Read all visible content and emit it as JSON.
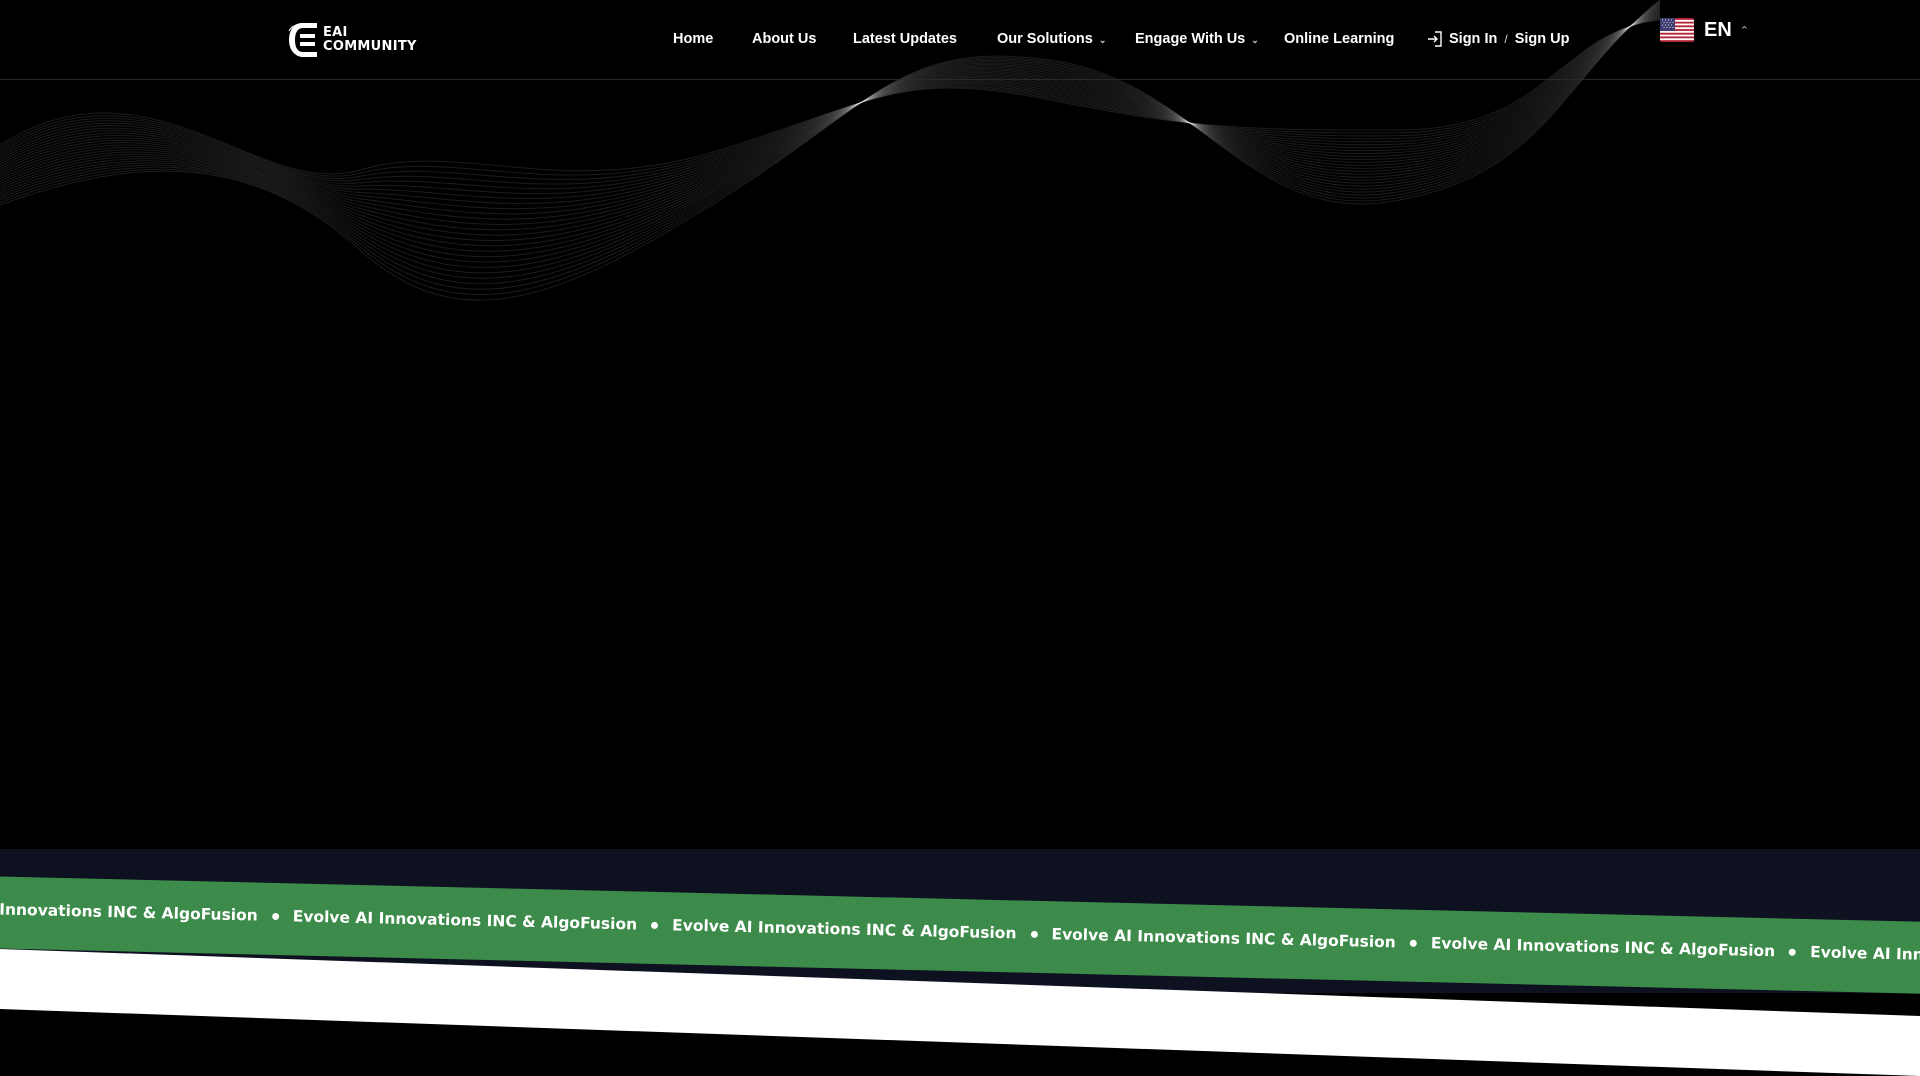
{
  "brand": {
    "name_line1": "EAI",
    "name_line2": "COMMUNITY"
  },
  "nav": {
    "items": [
      {
        "label": "Home"
      },
      {
        "label": "About Us"
      },
      {
        "label": "Latest Updates"
      },
      {
        "label": "Our Solutions",
        "has_dropdown": true
      },
      {
        "label": "Engage With Us",
        "has_dropdown": true
      },
      {
        "label": "Online Learning"
      }
    ],
    "sign_in": "Sign In",
    "separator": "/",
    "sign_up": "Sign Up",
    "sign_in_icon": "sign-in-icon"
  },
  "language": {
    "code": "EN",
    "flag_icon": "us-flag-icon",
    "caret_icon": "chevron-up-icon"
  },
  "ticker": {
    "first_text": "Innovations INC & AlgoFusion",
    "text": "Evolve AI Innovations INC & AlgoFusion",
    "last_text": "Evolve AI Innovation"
  },
  "colors": {
    "background": "#000000",
    "ribbon": "#3d8b4a",
    "band": "#0d1120"
  }
}
